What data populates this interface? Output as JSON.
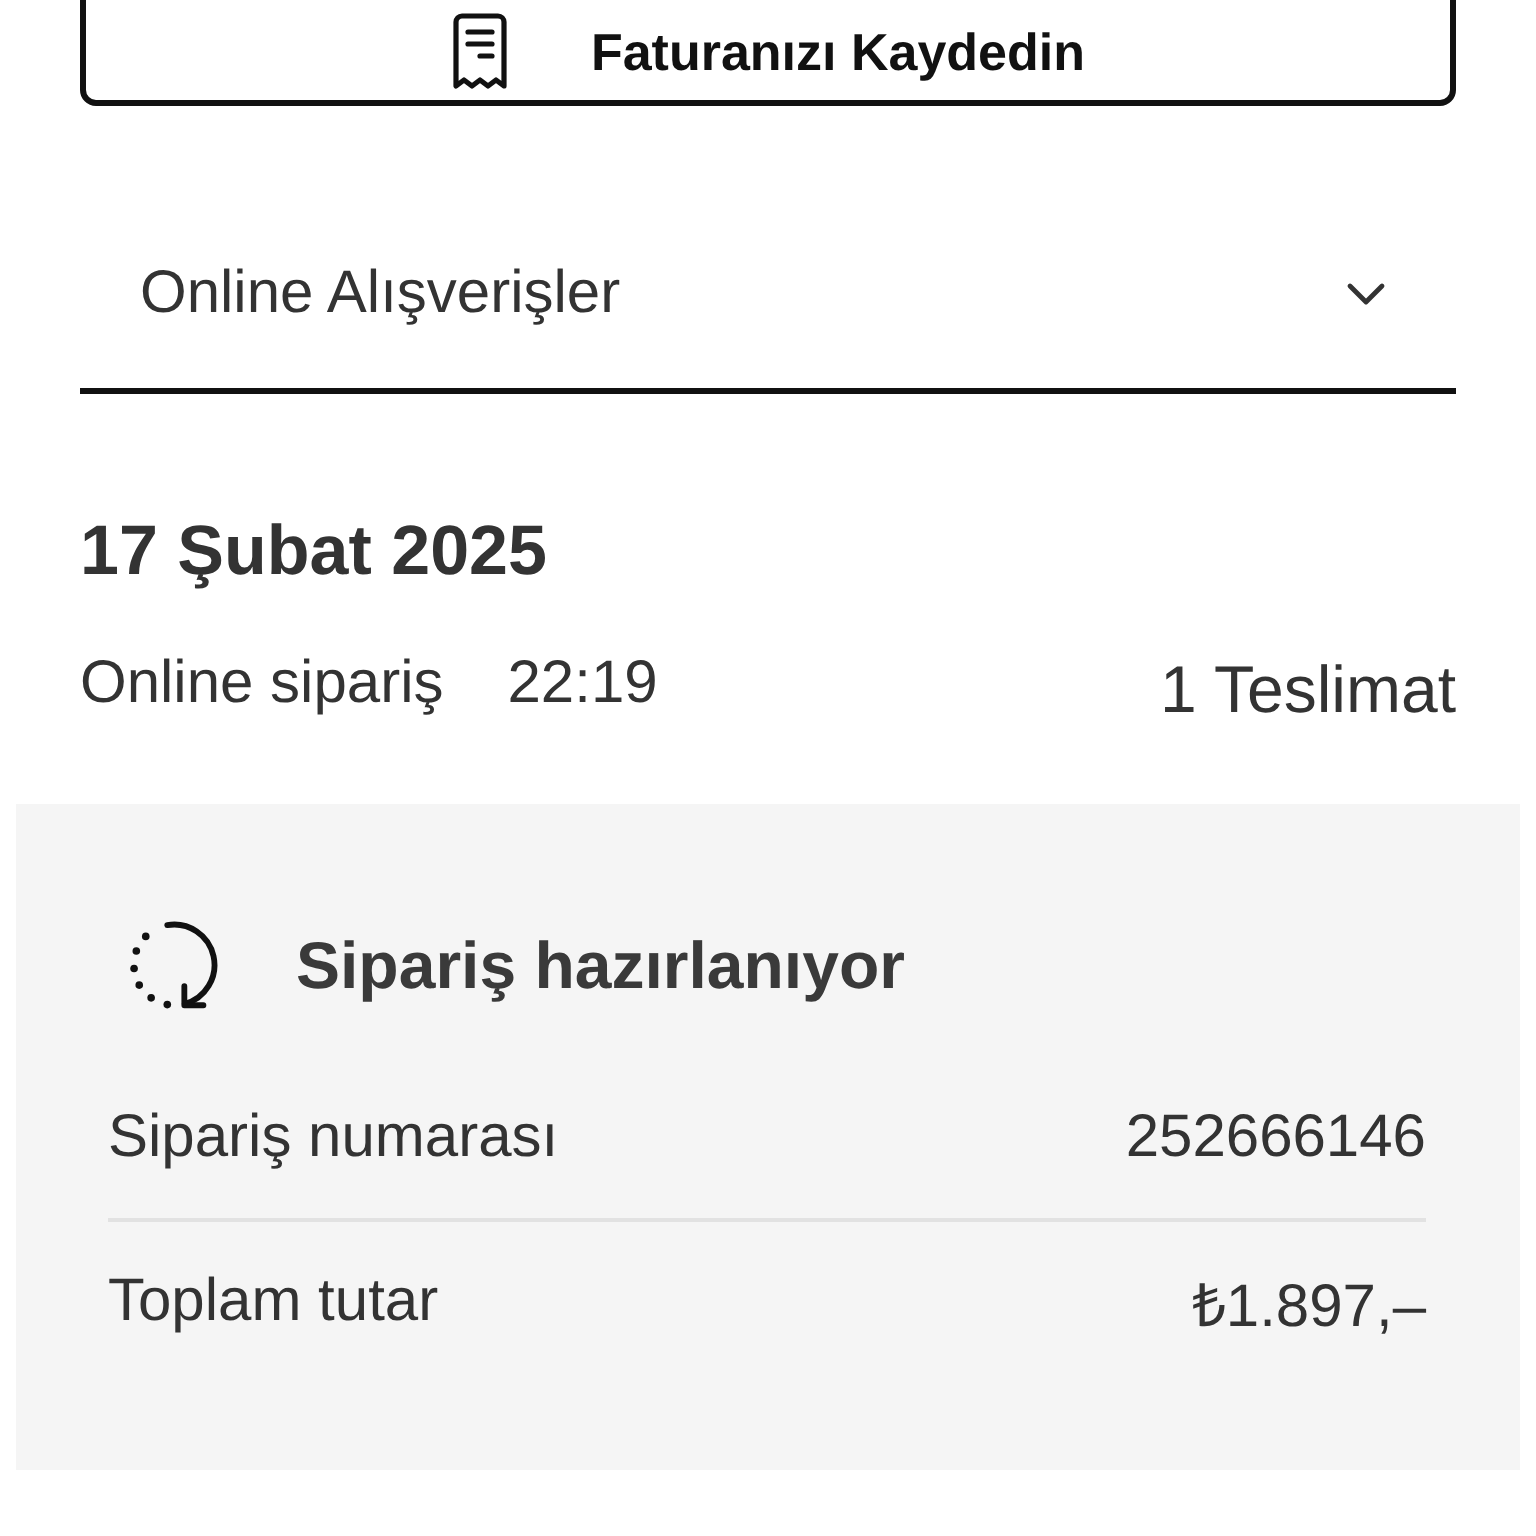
{
  "save_invoice_button": {
    "label": "Faturanızı Kaydedin"
  },
  "filter_dropdown": {
    "value": "Online Alışverişler"
  },
  "order": {
    "date": "17 Şubat 2025",
    "type": "Online sipariş",
    "time": "22:19",
    "deliveries": "1 Teslimat",
    "status": {
      "label": "Sipariş hazırlanıyor"
    },
    "details": [
      {
        "label": "Sipariş numarası",
        "value": "252666146"
      },
      {
        "label": "Toplam tutar",
        "value": "₺1.897,–"
      }
    ]
  }
}
